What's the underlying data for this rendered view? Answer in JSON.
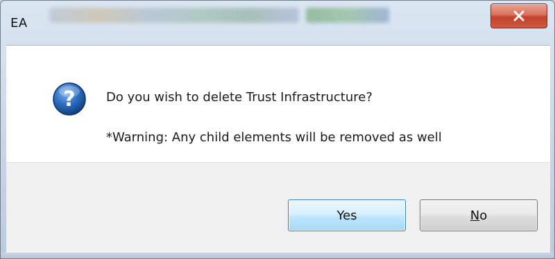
{
  "window": {
    "title": "EA"
  },
  "message": {
    "line1": "Do you wish to delete Trust Infrastructure?",
    "line2": "*Warning: Any child elements will be removed as well"
  },
  "buttons": {
    "yes_label": "Yes",
    "no_label_mnemonic": "N",
    "no_label_rest": "o"
  },
  "icons": {
    "dialog": "question-icon",
    "close": "close-icon"
  },
  "colors": {
    "close_button": "#c94a32",
    "default_button_border": "#3c7fb1",
    "question_icon": "#1f5fa8"
  }
}
